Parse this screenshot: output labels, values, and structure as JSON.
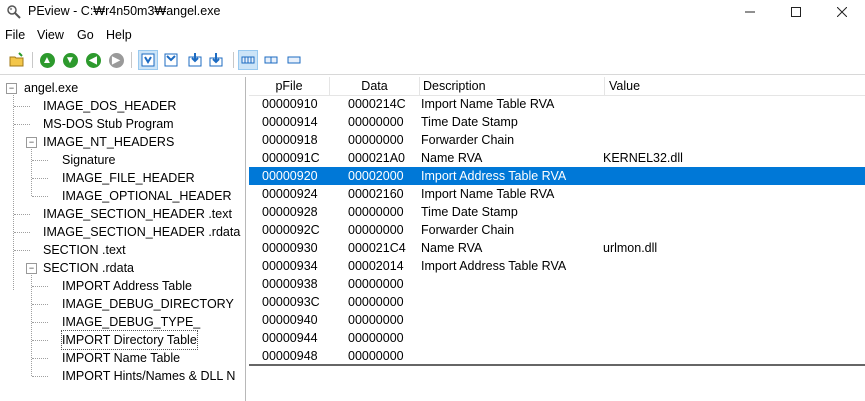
{
  "window": {
    "title": "PEview - C:₩r4n50m3₩angel.exe"
  },
  "menu": [
    "File",
    "View",
    "Go",
    "Help"
  ],
  "toolbar": {
    "buttons": [
      "open-icon",
      "back-icon",
      "forward-icon",
      "up-icon",
      "next-icon",
      "view-byte-icon",
      "view-word-icon",
      "view-dword-icon",
      "view-save-icon",
      "view-list-icon",
      "view-tile-icon",
      "view-small-icon"
    ]
  },
  "tree": {
    "items": [
      {
        "label": "angel.exe",
        "level": 0,
        "expander": "minus"
      },
      {
        "label": "IMAGE_DOS_HEADER",
        "level": 1
      },
      {
        "label": "MS-DOS Stub Program",
        "level": 1
      },
      {
        "label": "IMAGE_NT_HEADERS",
        "level": 1,
        "expander": "minus"
      },
      {
        "label": "Signature",
        "level": 2
      },
      {
        "label": "IMAGE_FILE_HEADER",
        "level": 2
      },
      {
        "label": "IMAGE_OPTIONAL_HEADER",
        "level": 2
      },
      {
        "label": "IMAGE_SECTION_HEADER .text",
        "level": 1
      },
      {
        "label": "IMAGE_SECTION_HEADER .rdata",
        "level": 1
      },
      {
        "label": "SECTION .text",
        "level": 1
      },
      {
        "label": "SECTION .rdata",
        "level": 1,
        "expander": "minus"
      },
      {
        "label": "IMPORT Address Table",
        "level": 2
      },
      {
        "label": "IMAGE_DEBUG_DIRECTORY",
        "level": 2
      },
      {
        "label": "IMAGE_DEBUG_TYPE_",
        "level": 2
      },
      {
        "label": "IMPORT Directory Table",
        "level": 2,
        "selected": true
      },
      {
        "label": "IMPORT Name Table",
        "level": 2
      },
      {
        "label": "IMPORT Hints/Names & DLL N",
        "level": 2
      }
    ]
  },
  "table": {
    "columns": [
      "pFile",
      "Data",
      "Description",
      "Value"
    ],
    "rows": [
      {
        "pFile": "00000910",
        "data": "0000214C",
        "description": "Import Name Table RVA",
        "value": ""
      },
      {
        "pFile": "00000914",
        "data": "00000000",
        "description": "Time Date Stamp",
        "value": ""
      },
      {
        "pFile": "00000918",
        "data": "00000000",
        "description": "Forwarder Chain",
        "value": ""
      },
      {
        "pFile": "0000091C",
        "data": "000021A0",
        "description": "Name RVA",
        "value": "KERNEL32.dll"
      },
      {
        "pFile": "00000920",
        "data": "00002000",
        "description": "Import Address Table RVA",
        "value": "",
        "selected": true
      },
      {
        "pFile": "00000924",
        "data": "00002160",
        "description": "Import Name Table RVA",
        "value": ""
      },
      {
        "pFile": "00000928",
        "data": "00000000",
        "description": "Time Date Stamp",
        "value": ""
      },
      {
        "pFile": "0000092C",
        "data": "00000000",
        "description": "Forwarder Chain",
        "value": ""
      },
      {
        "pFile": "00000930",
        "data": "000021C4",
        "description": "Name RVA",
        "value": "urlmon.dll"
      },
      {
        "pFile": "00000934",
        "data": "00002014",
        "description": "Import Address Table RVA",
        "value": ""
      },
      {
        "pFile": "00000938",
        "data": "00000000",
        "description": "",
        "value": ""
      },
      {
        "pFile": "0000093C",
        "data": "00000000",
        "description": "",
        "value": ""
      },
      {
        "pFile": "00000940",
        "data": "00000000",
        "description": "",
        "value": ""
      },
      {
        "pFile": "00000944",
        "data": "00000000",
        "description": "",
        "value": ""
      },
      {
        "pFile": "00000948",
        "data": "00000000",
        "description": "",
        "value": ""
      }
    ]
  },
  "colors": {
    "selection": "#0078d7",
    "selection_text": "#ffffff"
  }
}
